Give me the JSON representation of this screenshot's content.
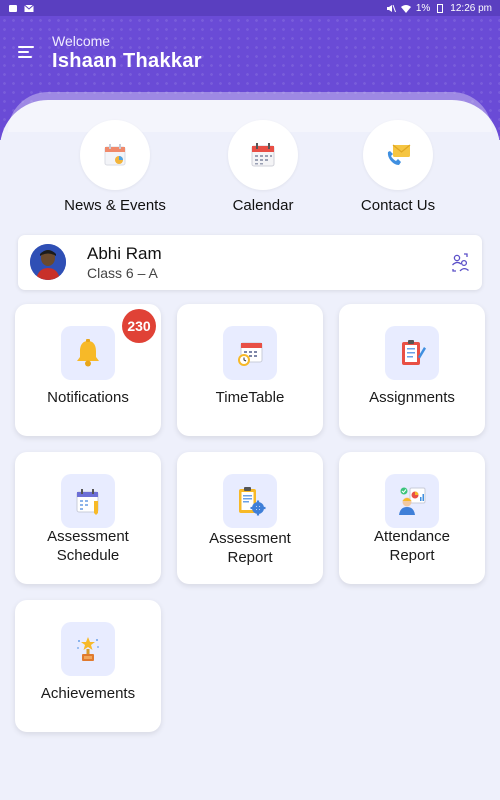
{
  "status_bar": {
    "time": "12:26 pm",
    "battery": "1%"
  },
  "header": {
    "welcome": "Welcome",
    "user_name": "Ishaan Thakkar"
  },
  "quick_links": [
    {
      "label": "News & Events",
      "icon": "news-events-icon"
    },
    {
      "label": "Calendar",
      "icon": "calendar-icon"
    },
    {
      "label": "Contact Us",
      "icon": "contact-us-icon"
    }
  ],
  "student": {
    "name": "Abhi Ram",
    "class": "Class 6 – A"
  },
  "tiles": [
    {
      "label": "Notifications",
      "icon": "bell-icon",
      "badge": "230"
    },
    {
      "label": "TimeTable",
      "icon": "timetable-icon"
    },
    {
      "label": "Assignments",
      "icon": "assignments-icon"
    },
    {
      "label": "Assessment\nSchedule",
      "icon": "assessment-schedule-icon"
    },
    {
      "label": "Assessment\nReport",
      "icon": "assessment-report-icon"
    },
    {
      "label": "Attendance\nReport",
      "icon": "attendance-report-icon"
    },
    {
      "label": "Achievements",
      "icon": "trophy-icon"
    }
  ],
  "colors": {
    "header": "#6a4bd6",
    "badge": "#e04236",
    "background": "#eef0fb"
  }
}
